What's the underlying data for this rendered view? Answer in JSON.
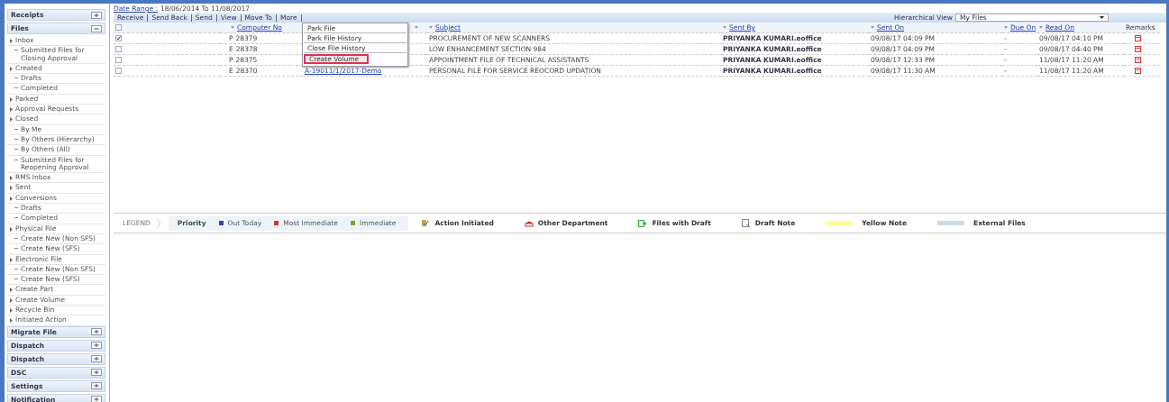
{
  "sidebar": {
    "sections": [
      {
        "title": "Receipts",
        "expanded": false
      },
      {
        "title": "Files",
        "expanded": true,
        "items": [
          {
            "label": "Inbox",
            "children": [
              {
                "label": "Submitted Files for Closing Approval"
              }
            ]
          },
          {
            "label": "Created",
            "children": [
              {
                "label": "Drafts"
              },
              {
                "label": "Completed"
              }
            ]
          },
          {
            "label": "Parked"
          },
          {
            "label": "Approval Requests"
          },
          {
            "label": "Closed",
            "children": [
              {
                "label": "By Me"
              },
              {
                "label": "By Others (Hierarchy)"
              },
              {
                "label": "By Others (All)"
              },
              {
                "label": "Submitted Files for Reopening Approval"
              }
            ]
          },
          {
            "label": "RMS Inbox"
          },
          {
            "label": "Sent"
          },
          {
            "label": "Conversions",
            "children": [
              {
                "label": "Drafts"
              },
              {
                "label": "Completed"
              }
            ]
          },
          {
            "label": "Physical File",
            "children": [
              {
                "label": "Create New (Non SFS)"
              },
              {
                "label": "Create New (SFS)"
              }
            ]
          },
          {
            "label": "Electronic File",
            "children": [
              {
                "label": "Create New (Non SFS)"
              },
              {
                "label": "Create New (SFS)"
              }
            ]
          },
          {
            "label": "Create Part"
          },
          {
            "label": "Create Volume"
          },
          {
            "label": "Recycle Bin"
          },
          {
            "label": "Initiated Action"
          }
        ]
      },
      {
        "title": "Migrate File",
        "expanded": false
      },
      {
        "title": "Dispatch",
        "expanded": false
      },
      {
        "title": "Dispatch",
        "expanded": false
      },
      {
        "title": "DSC",
        "expanded": false
      },
      {
        "title": "Settings",
        "expanded": false
      },
      {
        "title": "Notification",
        "expanded": false
      }
    ]
  },
  "date_range": {
    "label": "Date Range :",
    "value": "18/06/2014 To 11/08/2017"
  },
  "toolbar": {
    "actions": [
      "Receive",
      "Send Back",
      "Send",
      "View",
      "Move To",
      "More"
    ],
    "view_label": "Hierarchical View",
    "view_value": "My Files"
  },
  "more_menu": [
    {
      "label": "Park File",
      "selected": false
    },
    {
      "label": "Park File History",
      "selected": false
    },
    {
      "label": "Close File History",
      "selected": false
    },
    {
      "label": "Create Volume",
      "selected": true
    }
  ],
  "table": {
    "select_all_checked": false,
    "columns": [
      "Computer No",
      "Subject",
      "Sent By",
      "Sent On",
      "Due On",
      "Read On",
      "Remarks"
    ],
    "rows": [
      {
        "checked": true,
        "type": "P",
        "computer_no": "28379",
        "subject": "PROCUREMENT OF NEW SCANNERS",
        "sent_by": "PRIYANKA KUMARI.eoffice",
        "sent_on": "09/08/17 04:09 PM",
        "due_on": "-",
        "read_on": "09/08/17 04:10 PM"
      },
      {
        "checked": false,
        "type": "E",
        "computer_no": "28378",
        "subject": "LOW ENHANCEMENT SECTION 984",
        "sent_by": "PRIYANKA KUMARI.eoffice",
        "sent_on": "09/08/17 04:09 PM",
        "due_on": "-",
        "read_on": "09/08/17 04:40 PM"
      },
      {
        "checked": false,
        "type": "P",
        "computer_no": "28375",
        "subject": "APPOINTMENT FILE OF TECHNICAL ASSISTANTS",
        "sent_by": "PRIYANKA KUMARI.eoffice",
        "sent_on": "09/08/17 12:33 PM",
        "due_on": "-",
        "read_on": "11/08/17 11:20 AM"
      },
      {
        "checked": false,
        "type": "E",
        "computer_no": "28370",
        "file_no": "A-19011/1/2017-Demo",
        "subject": "PERSONAL FILE FOR SERVICE REOCORD UPDATION",
        "sent_by": "PRIYANKA KUMARI.eoffice",
        "sent_on": "09/08/17 11:30 AM",
        "due_on": "-",
        "read_on": "11/08/17 11:20 AM"
      }
    ]
  },
  "legend": {
    "title": "LEGEND",
    "priority_label": "Priority",
    "items": [
      {
        "kind": "swatch",
        "label": "Out Today",
        "color": "#3344bb"
      },
      {
        "kind": "swatch",
        "label": "Most Immediate",
        "color": "#cc3333"
      },
      {
        "kind": "swatch",
        "label": "Immediate",
        "color": "#77aa22"
      },
      {
        "kind": "icon",
        "label": "Action Initiated"
      },
      {
        "kind": "icon",
        "label": "Other Department"
      },
      {
        "kind": "icon",
        "label": "Files with Draft"
      },
      {
        "kind": "icon",
        "label": "Draft Note"
      },
      {
        "kind": "band",
        "label": "Yellow Note",
        "color": "#ffff99"
      },
      {
        "kind": "band",
        "label": "External Files",
        "color": "#c8dcf0"
      }
    ]
  }
}
